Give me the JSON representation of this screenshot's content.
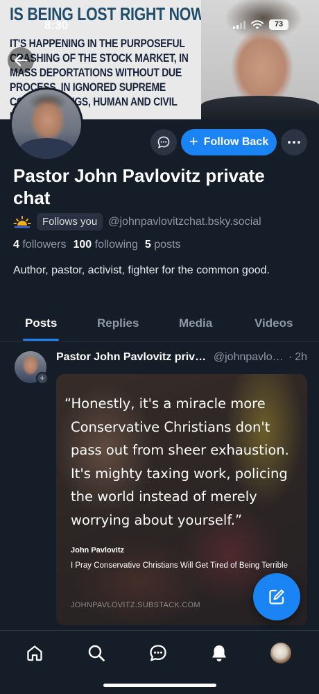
{
  "status_bar": {
    "time": "8:30",
    "battery": "73"
  },
  "banner": {
    "headline": "IS BEING LOST RIGHT NOW.",
    "body": "IT'S HAPPENING IN THE PURPOSEFUL CRASHING OF THE STOCK MARKET, IN MASS DEPORTATIONS WITHOUT DUE PROCESS, IN IGNORED SUPREME COURT RULINGS, HUMAN AND CIVIL RIGHTS"
  },
  "header": {
    "follow_label": "Follow Back"
  },
  "profile": {
    "display_name": "Pastor John Pavlovitz private chat",
    "follows_you": "Follows you",
    "handle": "@johnpavlovitzchat.bsky.social",
    "followers_count": "4",
    "followers_label": "followers",
    "following_count": "100",
    "following_label": "following",
    "posts_count": "5",
    "posts_label": "posts",
    "bio": "Author, pastor, activist, fighter for the common good."
  },
  "tabs": [
    "Posts",
    "Replies",
    "Media",
    "Videos"
  ],
  "active_tab": "Posts",
  "post": {
    "author": "Pastor John Pavlovitz private chat",
    "handle": "@johnpavlovitzchat.bsky.social",
    "dot": "·",
    "time": "2h",
    "quote_lines": [
      "“Honestly, it's a miracle more",
      "Conservative Christians don't",
      "pass out from sheer exhaustion.",
      "It's mighty taxing work, policing",
      "the world instead of merely",
      "worrying about yourself.”"
    ],
    "quote_author": "John Pavlovitz",
    "quote_source": "I Pray Conservative Christians Will Get Tired of Being Terrible",
    "quote_site": "JOHNPAVLOVITZ.SUBSTACK.COM"
  },
  "nav": [
    "home-icon",
    "search-icon",
    "chat-icon",
    "bell-icon",
    "profile-avatar"
  ],
  "colors": {
    "background": "#151d28",
    "accent": "#1b84f5",
    "muted_text": "#8d99a8",
    "pill_bg": "#2a3442"
  }
}
